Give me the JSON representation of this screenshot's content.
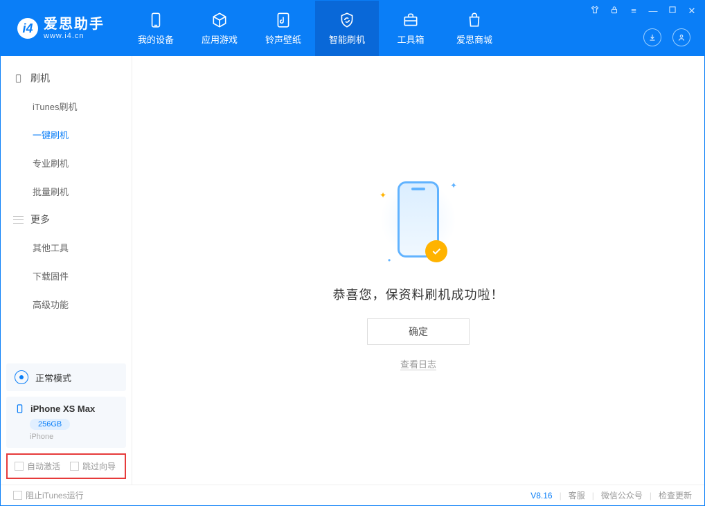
{
  "app": {
    "title": "爱思助手",
    "subtitle": "www.i4.cn"
  },
  "tabs": [
    {
      "label": "我的设备"
    },
    {
      "label": "应用游戏"
    },
    {
      "label": "铃声壁纸"
    },
    {
      "label": "智能刷机"
    },
    {
      "label": "工具箱"
    },
    {
      "label": "爱思商城"
    }
  ],
  "sidebar": {
    "group1_title": "刷机",
    "group1": [
      {
        "label": "iTunes刷机"
      },
      {
        "label": "一键刷机"
      },
      {
        "label": "专业刷机"
      },
      {
        "label": "批量刷机"
      }
    ],
    "group2_title": "更多",
    "group2": [
      {
        "label": "其他工具"
      },
      {
        "label": "下载固件"
      },
      {
        "label": "高级功能"
      }
    ]
  },
  "mode_label": "正常模式",
  "device": {
    "name": "iPhone XS Max",
    "storage": "256GB",
    "type": "iPhone"
  },
  "checks": {
    "auto_activate": "自动激活",
    "skip_guide": "跳过向导"
  },
  "main": {
    "success_msg": "恭喜您，保资料刷机成功啦！",
    "confirm": "确定",
    "view_log": "查看日志"
  },
  "footer": {
    "block_itunes": "阻止iTunes运行",
    "version": "V8.16",
    "support": "客服",
    "wechat": "微信公众号",
    "update": "检查更新"
  }
}
